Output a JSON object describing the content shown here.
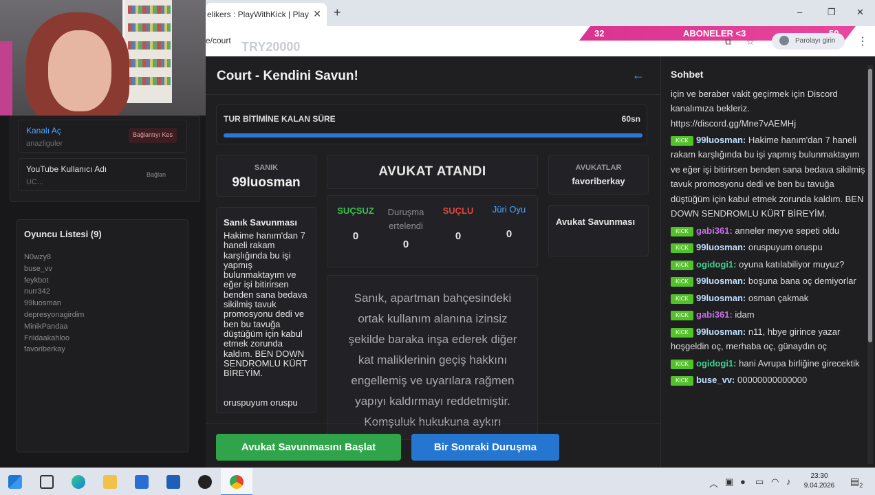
{
  "browser": {
    "tab_title": "elikers : PlayWithKick | Play",
    "tab_close": "✕",
    "new_tab": "+",
    "url": "e/court",
    "ghost_text": "TRY20000",
    "overlay": {
      "left_count": "32",
      "label": "ABONELER <3",
      "right_count": "50"
    },
    "password_pill": "Parolayı girin",
    "window_controls": {
      "minimize": "–",
      "maximize": "❐",
      "close": "✕"
    }
  },
  "sidebar": {
    "rows": [
      {
        "title": "Kanalı Aç",
        "subtitle": "anazliguler",
        "action": "Bağlantıyı Kes"
      },
      {
        "title": "YouTube Kullanıcı Adı",
        "subtitle": "UC...",
        "action": "Bağlan"
      }
    ],
    "players": {
      "title": "Oyuncu Listesi (9)",
      "items": [
        "N0wzy8",
        "buse_vv",
        "feykbot",
        "nurr342",
        "99luosman",
        "depresyonagirdim",
        "MinikPandaa",
        "Friidaakahloo",
        "favoriberkay"
      ]
    }
  },
  "court": {
    "title": "Court - Kendini Savun!",
    "back_icon": "←",
    "timer": {
      "label": "TUR BİTİMİNE KALAN SÜRE",
      "value": "60sn",
      "progress": 1.0
    },
    "defendant": {
      "label": "SANIK",
      "name": "99luosman"
    },
    "lawyer_status": "AVUKAT ATANDI",
    "lawyers": {
      "label": "AVUKATLAR",
      "name": "favoriberkay"
    },
    "defense": {
      "title": "Sanık Savunması",
      "text": "Hakime hanım'dan 7 haneli rakam karşlığında bu işi yapmış bulunmaktayım ve eğer işi bitirirsen benden sana bedava sikilmiş tavuk promosyonu dedi ve ben bu tavuğa düştüğüm için kabul etmek zorunda kaldım. BEN DOWN SENDROMLU KÜRT BİREYİM.",
      "extra": "oruspuyum oruspu"
    },
    "votes": [
      {
        "label": "SUÇSUZ",
        "count": "0",
        "color": "#35c24a"
      },
      {
        "label": "Duruşma ertelendi",
        "count": "0",
        "color": "#8e8e93"
      },
      {
        "label": "SUÇLU",
        "count": "0",
        "color": "#e2453c"
      },
      {
        "label": "Jüri Oyu",
        "count": "0",
        "color": "#4ea3ff"
      }
    ],
    "lawyer_defense_title": "Avukat Savunması",
    "case_text": "Sanık, apartman bahçesindeki ortak kullanım alanına izinsiz şekilde baraka inşa ederek diğer kat maliklerinin geçiş hakkını engellemiş ve uyarılara rağmen yapıyı kaldırmayı reddetmiştir. Komşuluk hukukuna aykırı",
    "buttons": {
      "start_defense": "Avukat Savunmasını Başlat",
      "next_trial": "Bir Sonraki Duruşma"
    }
  },
  "chat": {
    "title": "Sohbet",
    "intro": "için ve beraber vakit geçirmek için Discord kanalımıza bekleriz. https://discord.gg/Mne7vAEMHj",
    "badge": "KICK",
    "messages": [
      {
        "user": "99luosman:",
        "color": "#bfe0ff",
        "text": "Hakime hanım'dan 7 haneli rakam karşlığında bu işi yapmış bulunmaktayım ve eğer işi bitirirsen benden sana bedava sikilmiş tavuk promosyonu dedi ve ben bu tavuğa düştüğüm için kabul etmek zorunda kaldım. BEN DOWN SENDROMLU KÜRT BİREYİM."
      },
      {
        "user": "gabi361:",
        "color": "#c86ee6",
        "text": "anneler meyve sepeti oldu"
      },
      {
        "user": "99luosman:",
        "color": "#bfe0ff",
        "text": "oruspuyum oruspu"
      },
      {
        "user": "ogidogi1:",
        "color": "#3fcf8e",
        "text": "oyuna katılabiliyor muyuz?"
      },
      {
        "user": "99luosman:",
        "color": "#bfe0ff",
        "text": "boşuna bana oç demiyorlar"
      },
      {
        "user": "99luosman:",
        "color": "#bfe0ff",
        "text": "osman çakmak"
      },
      {
        "user": "gabi361:",
        "color": "#c86ee6",
        "text": "idam"
      },
      {
        "user": "99luosman:",
        "color": "#bfe0ff",
        "text": "n11, hbye girince yazar hoşgeldin oç, merhaba oç, günaydın oç"
      },
      {
        "user": "ogidogi1:",
        "color": "#3fcf8e",
        "text": "hani Avrupa birliğine girecektik"
      },
      {
        "user": "buse_vv:",
        "color": "#bfe0ff",
        "text": "00000000000000"
      }
    ]
  },
  "taskbar": {
    "time": "23:30",
    "date": "9.04.2026",
    "notification_count": "2"
  }
}
